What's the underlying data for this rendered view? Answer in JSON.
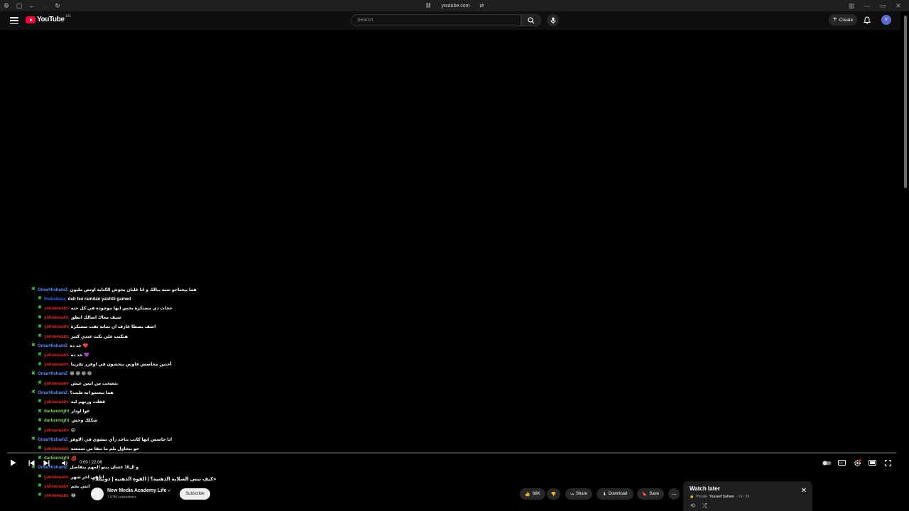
{
  "browser": {
    "url": "youtube.com"
  },
  "masthead": {
    "logo_text": "YouTube",
    "logo_suffix": "EG",
    "search_placeholder": "Search",
    "create_label": "Create",
    "avatar_letter": "Y"
  },
  "chat": [
    {
      "user": "OmarHishamZ",
      "text": "هما بيحتاجو سنة بيالك و انا غلبان بحوش الكتابة اوتص مليون",
      "color": "#5b8cff",
      "indent": 0
    },
    {
      "user": "thebsdass",
      "text": "dah fee ramdan yashtil gamed",
      "color": "#2d6bff",
      "indent": 1
    },
    {
      "user": "yahiawaaim",
      "text": "حجات دي مستكرة بحس انها موجوده في كل حته",
      "color": "#e0271b",
      "indent": 1
    },
    {
      "user": "yahiawaaim",
      "text": "شيف معاك اسالك انطق",
      "color": "#e0271b",
      "indent": 1
    },
    {
      "user": "yahiawaaim",
      "text": "اسف بسطا عارف ان تمانه بقت مستكرة",
      "color": "#e0271b",
      "indent": 1
    },
    {
      "user": "yahiawaaim",
      "text": "هتكتب علي نكت عندي كتير",
      "color": "#e0271b",
      "indent": 1
    },
    {
      "user": "OmarHishamZ",
      "text": "خد ده ❤️",
      "color": "#5b8cff",
      "indent": 0
    },
    {
      "user": "yahiawaaim",
      "text": "خد ده 💜",
      "color": "#e0271b",
      "indent": 1
    },
    {
      "user": "yahiawaaim",
      "text": "أختين مخاصش قاوس بيخشون في اوفرز تقريبا",
      "color": "#e0271b",
      "indent": 1
    },
    {
      "user": "OmarHishamZ",
      "text": "😁 😁 😁 😁",
      "color": "#5b8cff",
      "indent": 0
    },
    {
      "user": "yahiawaaim",
      "text": "بتشحت من ايمن عيش",
      "color": "#e0271b",
      "indent": 1
    },
    {
      "user": "OmarHishamZ",
      "text": "هما بيعتمو ايه طيب؟",
      "color": "#5b8cff",
      "indent": 0
    },
    {
      "user": "yahiawaaim",
      "text": "قفلت ورنهم ليه",
      "color": "#e0271b",
      "indent": 1
    },
    {
      "user": "darkennight",
      "text": "عوا اوتار",
      "color": "#7fd35a",
      "indent": 1
    },
    {
      "user": "darkennight",
      "text": "شكلك وحش",
      "color": "#7fd35a",
      "indent": 1
    },
    {
      "user": "yahiawaaim",
      "text": "😡",
      "color": "#e0271b",
      "indent": 1
    },
    {
      "user": "OmarHishamZ",
      "text": "انا حاسس انها كانت بتاخد رأي بيشوي في الاوفز",
      "color": "#5b8cff",
      "indent": 0
    },
    {
      "user": "yahiawaaim",
      "text": "جو بيحاول يلم ما تبقا من سمعته",
      "color": "#e0271b",
      "indent": 1
    },
    {
      "user": "darkennight",
      "text": "💋",
      "color": "#7fd35a",
      "indent": 1
    },
    {
      "user": "OmarHishamZ",
      "text": "و ال16 عشان بيتو المهم بيفاصل",
      "color": "#5b8cff",
      "indent": 0
    },
    {
      "user": "yahiawaaim",
      "text": "انا في اخر شهر",
      "color": "#e0271b",
      "indent": 1
    },
    {
      "user": "yahiawaaim",
      "text": "انتي بجم",
      "color": "#e0271b",
      "indent": 1
    },
    {
      "user": "yahiawaaim",
      "text": "😂",
      "color": "#e0271b",
      "indent": 1
    }
  ],
  "player": {
    "time": "0:00 / 22:06",
    "progress": 0
  },
  "video": {
    "title": "«كيف تبني الصلابة الذهنية؟ | القوة الذهنية | دوبيللا»",
    "channel_name": "New Media Academy Life",
    "subscribers": "7.67M subscribers",
    "subscribe_label": "Subscribe",
    "likes": "66K",
    "share_label": "Share",
    "download_label": "Download",
    "save_label": "Save"
  },
  "watch_later": {
    "title": "Watch later",
    "privacy": "Private",
    "owner": "Youssef Saheer",
    "position": "- 51 / 59"
  }
}
